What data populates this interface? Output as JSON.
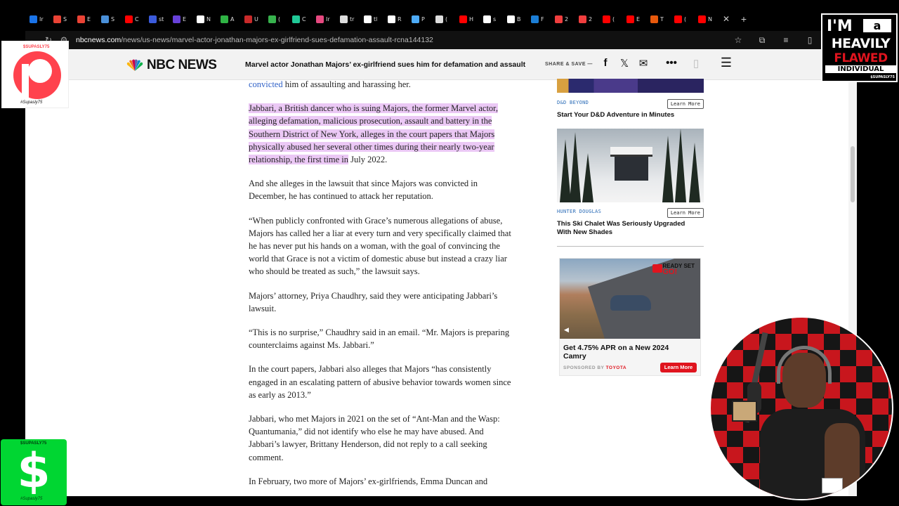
{
  "browser": {
    "tabs": [
      {
        "icon": "generic-tab-icon",
        "color": "#1a73e8",
        "label": "Ir"
      },
      {
        "icon": "gmail-icon",
        "color": "#ea4335",
        "label": "S"
      },
      {
        "icon": "gmail-icon",
        "color": "#ea4335",
        "label": "E"
      },
      {
        "icon": "generic-tab-icon",
        "color": "#4a90d9",
        "label": "S"
      },
      {
        "icon": "youtube-icon",
        "color": "#ff0000",
        "label": "C"
      },
      {
        "icon": "generic-tab-icon",
        "color": "#3b5bdb",
        "label": "st"
      },
      {
        "icon": "generic-tab-icon",
        "color": "#6741d9",
        "label": "E"
      },
      {
        "icon": "generic-tab-icon",
        "color": "#ffffff",
        "label": "N"
      },
      {
        "icon": "generic-tab-icon",
        "color": "#2fb344",
        "label": "A"
      },
      {
        "icon": "generic-tab-icon",
        "color": "#c92a2a",
        "label": "U"
      },
      {
        "icon": "generic-tab-icon",
        "color": "#37b24d",
        "label": "("
      },
      {
        "icon": "generic-tab-icon",
        "color": "#20c997",
        "label": "C"
      },
      {
        "icon": "instagram-icon",
        "color": "#e64980",
        "label": "Ir"
      },
      {
        "icon": "x-icon",
        "color": "#dddddd",
        "label": "tr"
      },
      {
        "icon": "google-icon",
        "color": "#ffffff",
        "label": "tl"
      },
      {
        "icon": "google-icon",
        "color": "#ffffff",
        "label": "R"
      },
      {
        "icon": "generic-tab-icon",
        "color": "#4dabf7",
        "label": "P"
      },
      {
        "icon": "tiktok-icon",
        "color": "#dddddd",
        "label": "("
      },
      {
        "icon": "youtube-icon",
        "color": "#ff0000",
        "label": "H"
      },
      {
        "icon": "google-icon",
        "color": "#ffffff",
        "label": "s"
      },
      {
        "icon": "generic-tab-icon",
        "color": "#ffffff",
        "label": "B"
      },
      {
        "icon": "generic-tab-icon",
        "color": "#1c7ed6",
        "label": "F"
      },
      {
        "icon": "generic-tab-icon",
        "color": "#f03e3e",
        "label": "2"
      },
      {
        "icon": "generic-tab-icon",
        "color": "#f03e3e",
        "label": "2"
      },
      {
        "icon": "youtube-icon",
        "color": "#ff0000",
        "label": "("
      },
      {
        "icon": "youtube-icon",
        "color": "#ff0000",
        "label": "E"
      },
      {
        "icon": "generic-tab-icon",
        "color": "#e8590c",
        "label": "T"
      },
      {
        "icon": "youtube-icon",
        "color": "#ff0000",
        "label": "("
      },
      {
        "icon": "youtube-icon",
        "color": "#ff0000",
        "label": "N"
      }
    ],
    "url_host": "nbcnews.com",
    "url_path": "/news/us-news/marvel-actor-jonathan-majors-ex-girlfriend-sues-defamation-assault-rcna144132"
  },
  "header": {
    "logo_text": "NBC NEWS",
    "headline": "Marvel actor Jonathan Majors’ ex-girlfriend sues him for defamation and assault",
    "share_save": "SHARE & SAVE —"
  },
  "article": {
    "p0_link": "convicted",
    "p0_rest": " him of assaulting and harassing her.",
    "p1_highlight": "Jabbari, a British dancer who is suing Majors, the former Marvel actor, alleging defamation, malicious prosecution, assault and battery in the Southern District of New York, alleges in the court papers that Majors physically abused her several other times during their nearly two-year relationship, the first time in",
    "p1_rest": " July 2022.",
    "p2": "And she alleges in the lawsuit that since Majors was convicted in December, he has continued to attack her reputation.",
    "p3": "“When publicly confronted with Grace’s numerous allegations of abuse, Majors has called her a liar at every turn and very specifically claimed that he has never put his hands on a woman, with the goal of convincing the world that Grace is not a victim of domestic abuse but instead a crazy liar who should be treated as such,” the lawsuit says.",
    "p4": "Majors’ attorney, Priya Chaudhry, said they were anticipating Jabbari’s lawsuit.",
    "p5": "“This is no surprise,” Chaudhry said in an email. “Mr. Majors is preparing counterclaims against Ms. Jabbari.”",
    "p6": "In the court papers, Jabbari also alleges that Majors “has consistently engaged in an escalating pattern of abusive behavior towards women since as early as 2013.”",
    "p7": "Jabbari, who met Majors in 2021 on the set of “Ant-Man and the Wasp: Quantumania,” did not identify who else he may have abused. And Jabbari’s lawyer, Brittany Henderson, did not reply to a call seeking comment.",
    "p8": "In February, two more of Majors’ ex-girlfriends, Emma Duncan and"
  },
  "sidebar": {
    "ad1": {
      "sponsor": "D&D BEYOND",
      "button": "Learn More",
      "title": "Start Your D&D Adventure in Minutes"
    },
    "ad2": {
      "sponsor": "HUNTER DOUGLAS",
      "button": "Learn More",
      "title": "This Ski Chalet Was Seriously Upgraded With New Shades"
    },
    "ad3": {
      "ready": "READY SET",
      "go": "GO!",
      "title": "Get 4.75% APR on a New 2024 Camry",
      "sponsored_by": "SPONSORED BY ",
      "brand": "TOYOTA",
      "button": "Learn More"
    }
  },
  "overlays": {
    "patreon_handle": "$SUPASLY75",
    "patreon_sig": "#Supasly75",
    "badge_lines": [
      "I'M",
      "a",
      "HEAVILY",
      "FLAWED",
      "INDIVIDUAL"
    ],
    "badge_handle": "$SUPASLY75",
    "cash_handle": "$SUPASLY75",
    "cash_symbol": "$",
    "cash_sig": "#Supasly75"
  },
  "colors": {
    "link": "#3061c7",
    "highlight": "#ebc8f5",
    "patreon": "#ff424d",
    "cashapp": "#00d632",
    "toyota_red": "#e0141e"
  }
}
